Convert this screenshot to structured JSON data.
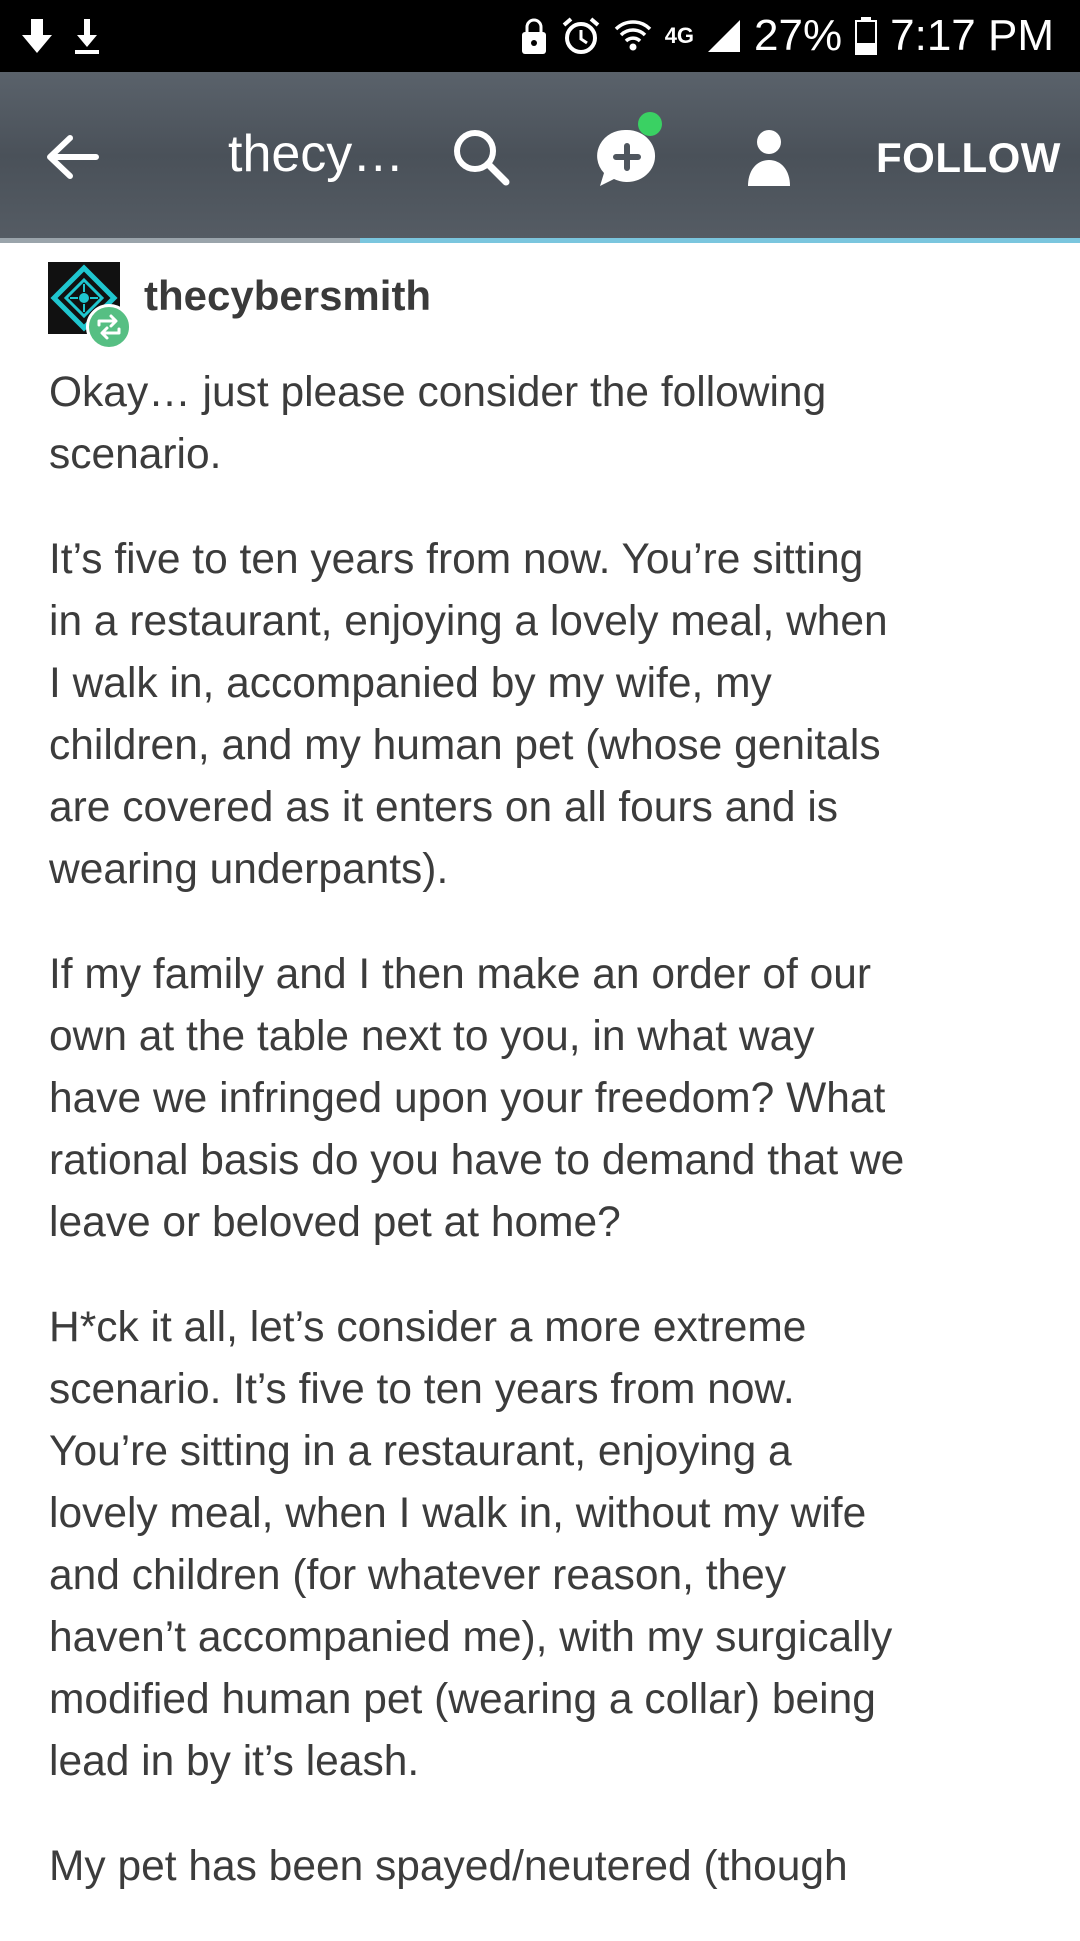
{
  "status_bar": {
    "network": "4G",
    "battery": "27%",
    "time": "7:17 PM"
  },
  "header": {
    "blog_title": "thecy…",
    "follow_label": "FOLLOW"
  },
  "post": {
    "username": "thecybersmith",
    "paragraphs": [
      "Okay… just please consider the following\nscenario.",
      "It’s five to ten years from now. You’re sitting\nin a restaurant, enjoying a lovely meal, when\nI walk in, accompanied by my wife, my\nchildren, and my human pet (whose genitals\nare covered as it enters on all fours and is\nwearing underpants).",
      "If my family and I then make an order of our\nown at the table next to you, in what way\nhave we infringed upon your freedom? What\nrational basis do you have to demand that we\nleave or beloved pet at home?",
      "H*ck it all, let’s consider a more extreme\nscenario.  It’s five to ten years from now.\nYou’re sitting in a restaurant, enjoying a\nlovely meal, when I walk in, without my wife\nand children (for whatever reason, they\nhaven’t accompanied me), with my surgically\nmodified human pet (wearing a collar) being\nlead in by it’s leash.",
      "My pet has been spayed/neutered (though"
    ]
  },
  "colors": {
    "header_bg": "#4f565e",
    "accent_line": "#7ac6de",
    "reblog_badge": "#56bf83",
    "notification_dot": "#3ad163",
    "avatar_accent": "#1fc6cf"
  },
  "icons": {
    "status_left": [
      "download-arrow-icon",
      "download-tray-icon"
    ],
    "status_right": [
      "lock-icon",
      "alarm-icon",
      "wifi-icon",
      "signal-icon",
      "battery-icon"
    ],
    "header": [
      "back-arrow-icon",
      "search-icon",
      "new-message-icon",
      "account-icon"
    ],
    "post": [
      "reblog-icon"
    ]
  }
}
